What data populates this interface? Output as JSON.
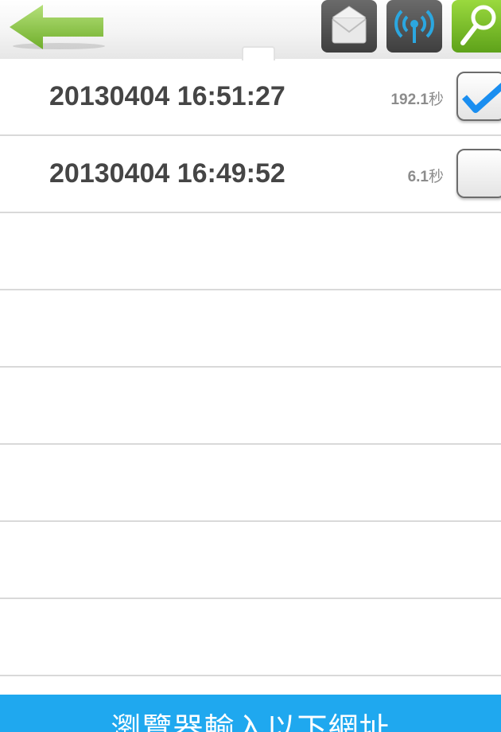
{
  "toolbar": {
    "back_icon": "back-arrow-icon",
    "buttons": [
      {
        "name": "mail-button",
        "icon": "envelope-icon"
      },
      {
        "name": "signal-button",
        "icon": "broadcast-antenna-icon"
      },
      {
        "name": "search-button",
        "icon": "magnifier-icon"
      }
    ],
    "colors": {
      "back_arrow": "#8cc63f",
      "dark_button": "#4a4a4a",
      "green_button": "#7cc12a",
      "signal_icon": "#2ba7e0"
    }
  },
  "recordings": [
    {
      "timestamp": "20130404 16:51:27",
      "duration": "192.1",
      "unit": "秒",
      "checked": true
    },
    {
      "timestamp": "20130404 16:49:52",
      "duration": "6.1",
      "unit": "秒",
      "checked": false
    }
  ],
  "empty_rows": 6,
  "footer": {
    "text": "瀏覽器輸入以下網址",
    "color": "#1fa8ef"
  },
  "check_color": "#1a8ef0"
}
